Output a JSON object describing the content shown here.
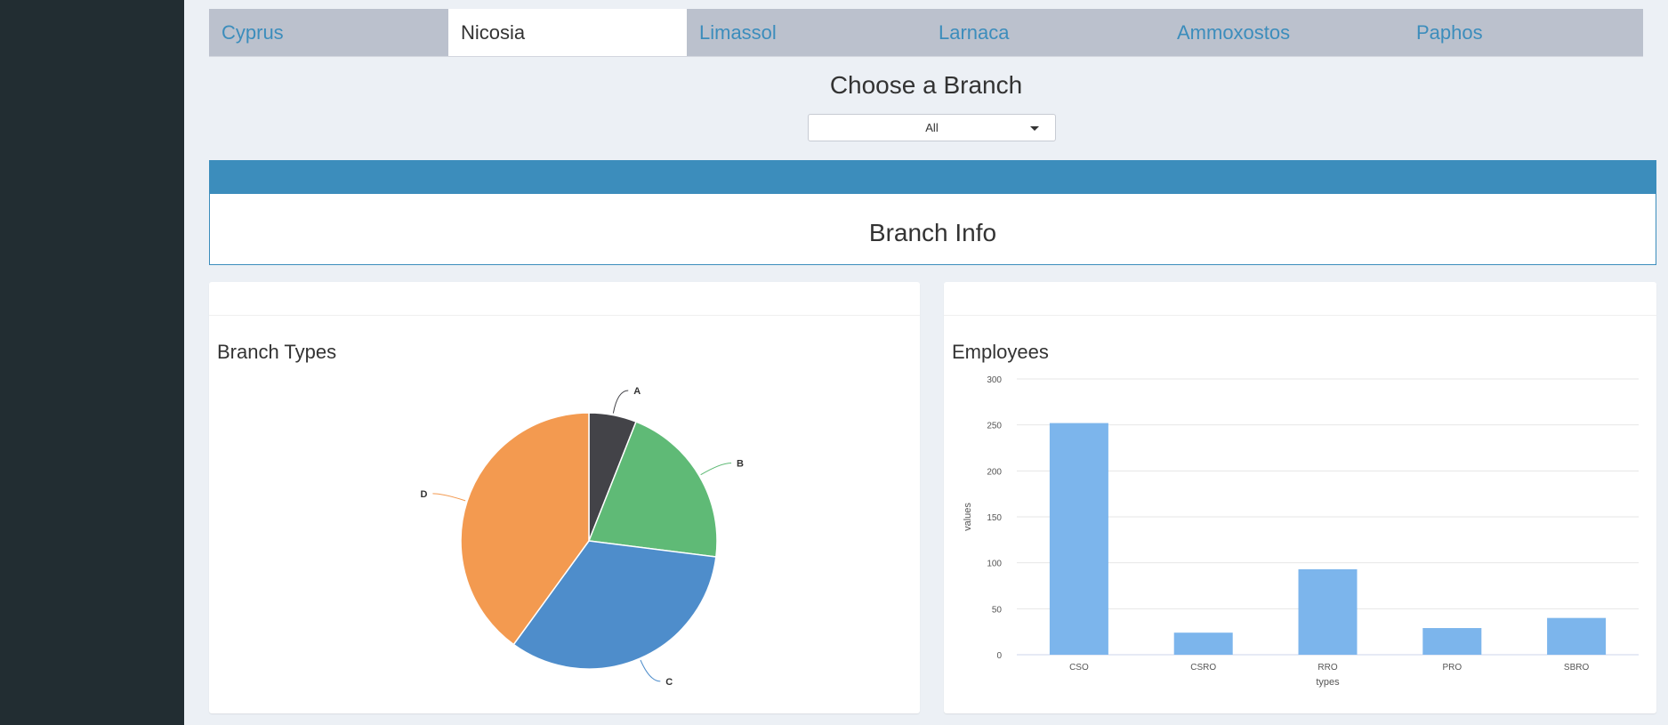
{
  "tabs": [
    {
      "label": "Cyprus",
      "active": false
    },
    {
      "label": "Nicosia",
      "active": true
    },
    {
      "label": "Limassol",
      "active": false
    },
    {
      "label": "Larnaca",
      "active": false
    },
    {
      "label": "Ammoxostos",
      "active": false
    },
    {
      "label": "Paphos",
      "active": false
    }
  ],
  "branch_select": {
    "title": "Choose a Branch",
    "value": "All"
  },
  "info": {
    "title": "Branch Info"
  },
  "pie_panel": {
    "title": "Branch Types"
  },
  "bar_panel": {
    "title": "Employees"
  },
  "colors": {
    "accent": "#3c8dbc",
    "bar": "#7cb5ec",
    "sidebar": "#222d32"
  },
  "chart_data": [
    {
      "type": "pie",
      "title": "Branch Types",
      "slices": [
        {
          "label": "A",
          "value": 6,
          "color": "#434348"
        },
        {
          "label": "B",
          "value": 21,
          "color": "#5fba76"
        },
        {
          "label": "C",
          "value": 33,
          "color": "#4e8dcb"
        },
        {
          "label": "D",
          "value": 40,
          "color": "#f39a50"
        }
      ]
    },
    {
      "type": "bar",
      "title": "Employees",
      "categories": [
        "CSO",
        "CSRO",
        "RRO",
        "PRO",
        "SBRO"
      ],
      "values": [
        252,
        24,
        93,
        29,
        40
      ],
      "xlabel": "types",
      "ylabel": "values",
      "ylim": [
        0,
        300
      ],
      "yticks": [
        0,
        50,
        100,
        150,
        200,
        250,
        300
      ],
      "grid": true
    }
  ]
}
